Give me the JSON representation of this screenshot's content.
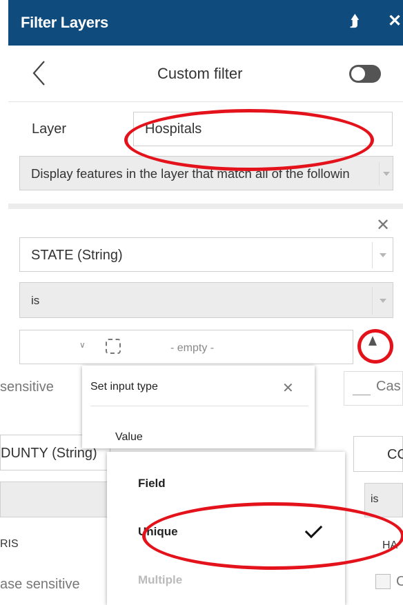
{
  "header": {
    "title": "Filter Layers",
    "collapse_icon": "double-chevron-up",
    "close_icon": "close"
  },
  "subheader": {
    "back_icon": "chevron-left",
    "title": "Custom filter",
    "toggle_on": false
  },
  "layer": {
    "label": "Layer",
    "value": "Hospitals"
  },
  "match_mode": {
    "value": "Display features in the layer that match all of the followin"
  },
  "expression": {
    "field": "STATE (String)",
    "operator": "is",
    "value_placeholder": "- empty -"
  },
  "case_sensitive_left": "sensitive",
  "case_sensitive_right": "Cas",
  "row2_left": {
    "field": "DUNTY (String)",
    "value": "RIS",
    "case": "ase sensitive"
  },
  "row2_right": {
    "field": "CC",
    "operator": "is",
    "value": "HA"
  },
  "set_input_popup": {
    "title": "Set input type",
    "first_option": "Value"
  },
  "input_type_menu": {
    "items": [
      {
        "label": "Field",
        "checked": false,
        "disabled": false
      },
      {
        "label": "Unique",
        "checked": true,
        "disabled": false
      },
      {
        "label": "Multiple",
        "checked": false,
        "disabled": true
      }
    ]
  },
  "colors": {
    "header_bg": "#0f4b7d",
    "annotation": "#e3121b"
  }
}
